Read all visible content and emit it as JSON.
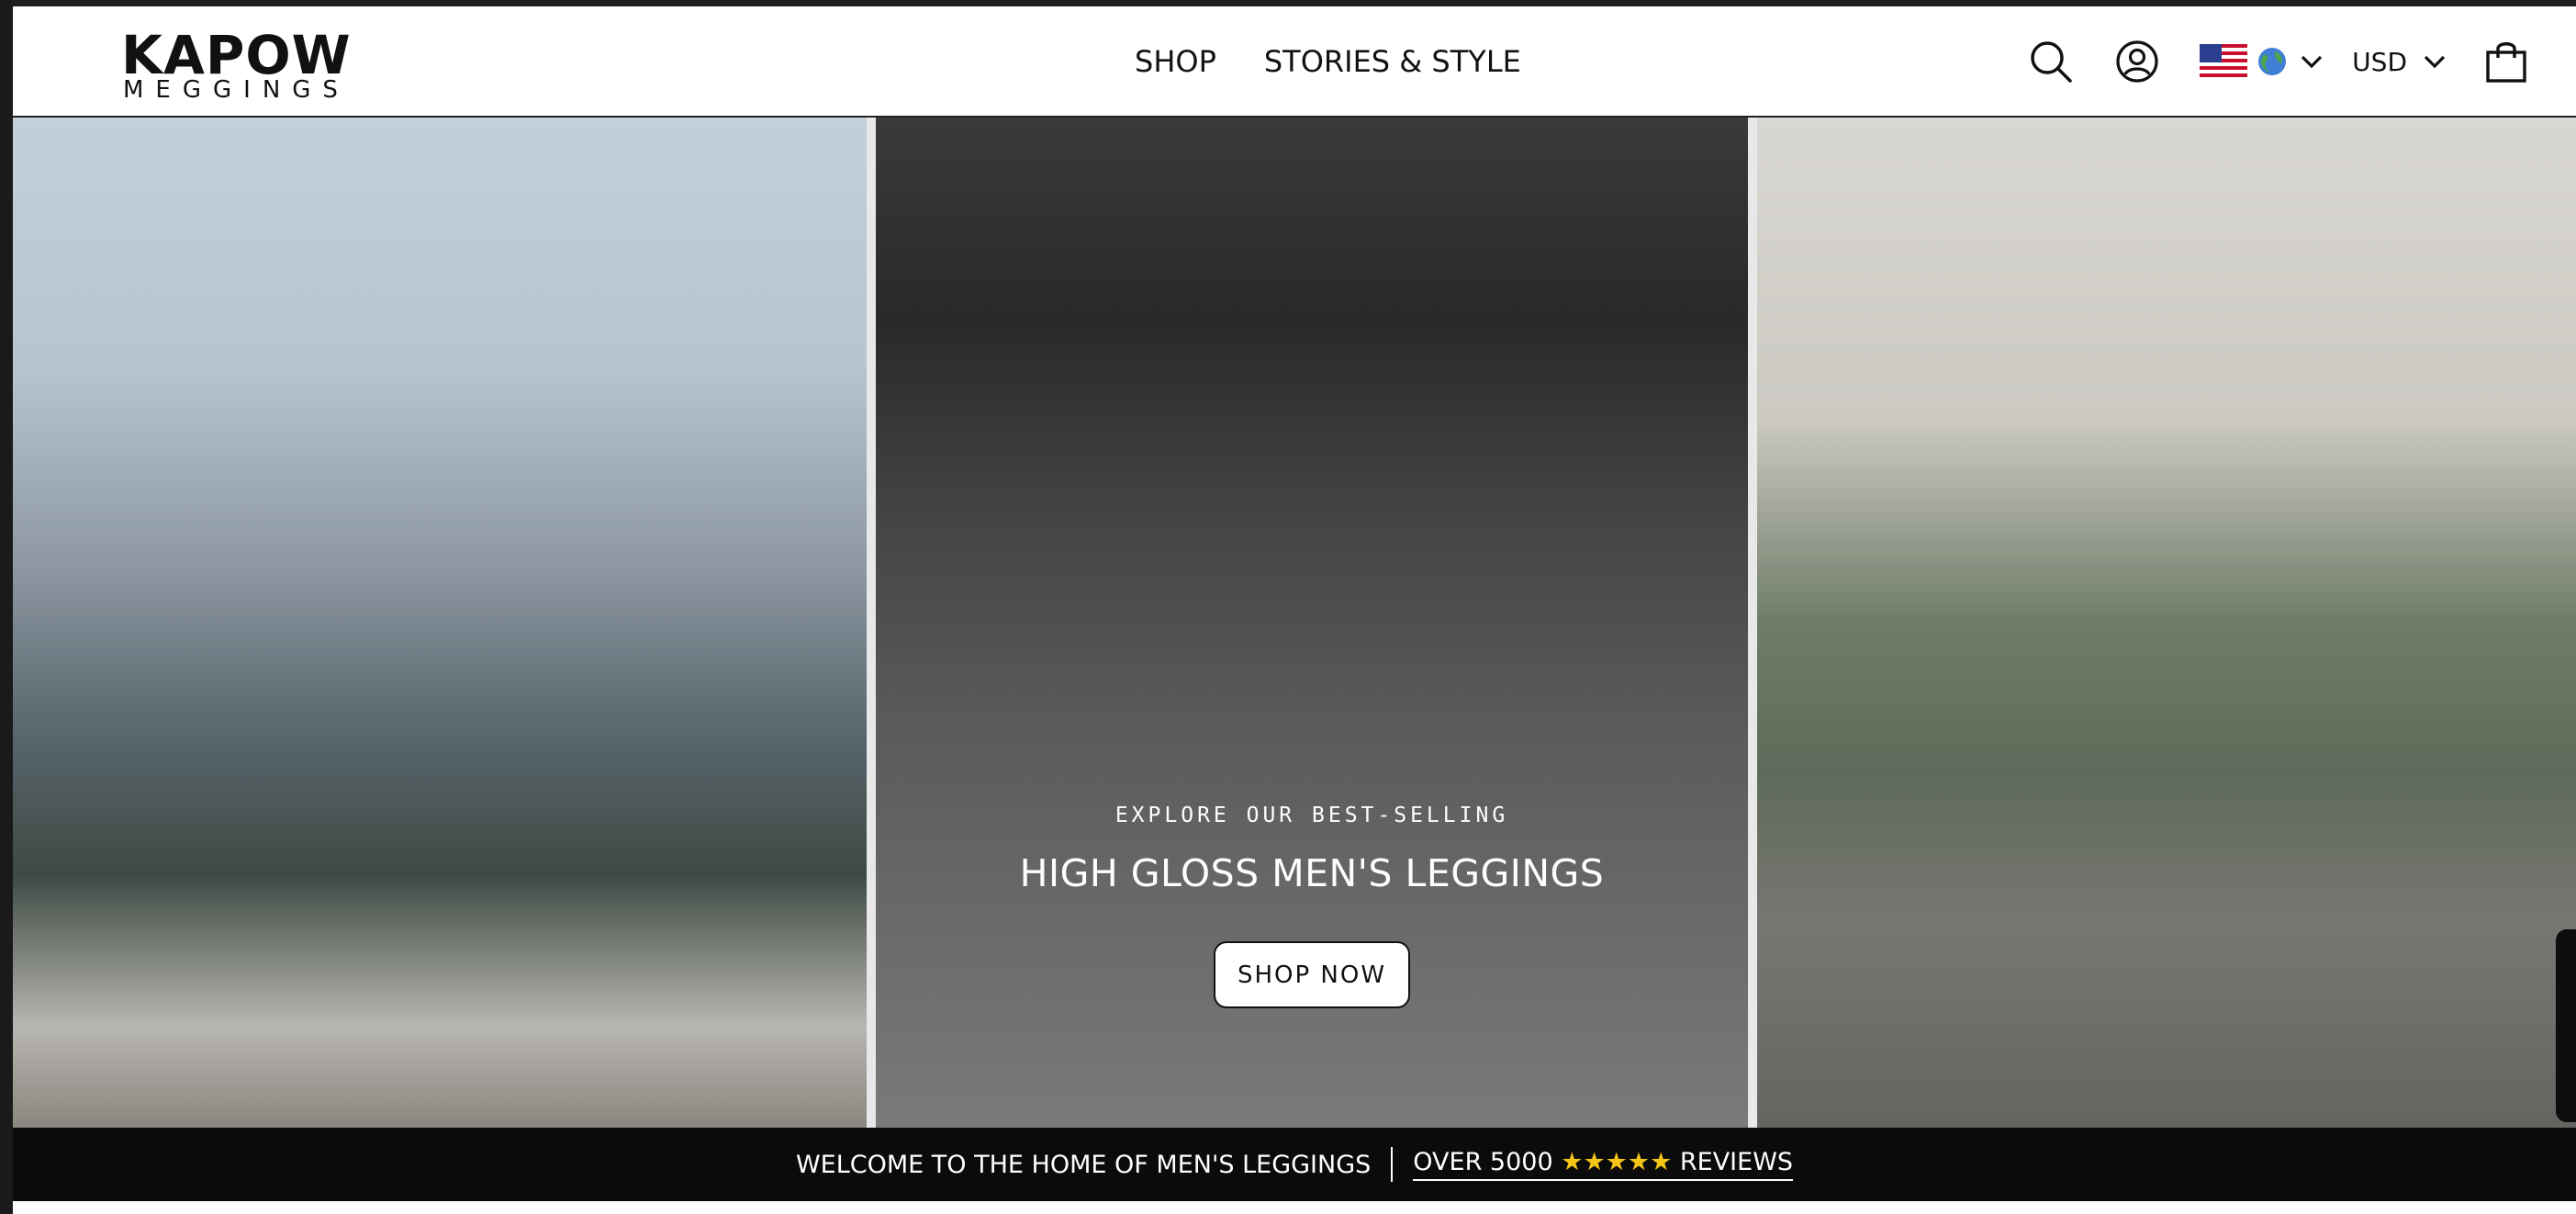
{
  "brand": {
    "name": "KAPOW",
    "tagline": "MEGGINGS"
  },
  "nav": {
    "items": [
      {
        "label": "SHOP"
      },
      {
        "label": "STORIES & STYLE"
      }
    ]
  },
  "header_tools": {
    "search_icon": "search-icon",
    "account_icon": "account-icon",
    "locale": {
      "flag": "us-flag-icon",
      "globe": "globe-icon"
    },
    "currency": "USD",
    "cart_icon": "cart-icon"
  },
  "hero": {
    "eyebrow": "EXPLORE OUR BEST-SELLING",
    "title": "HIGH GLOSS MEN'S LEGGINGS",
    "cta_label": "SHOP NOW"
  },
  "announcement": {
    "welcome": "WELCOME TO THE HOME OF MEN'S LEGGINGS",
    "reviews_prefix": "OVER 5000",
    "reviews_stars": "★★★★★",
    "reviews_suffix": "REVIEWS"
  },
  "colors": {
    "text": "#111111",
    "announcement_bg": "#0b0b0b",
    "star": "#f5c518"
  }
}
